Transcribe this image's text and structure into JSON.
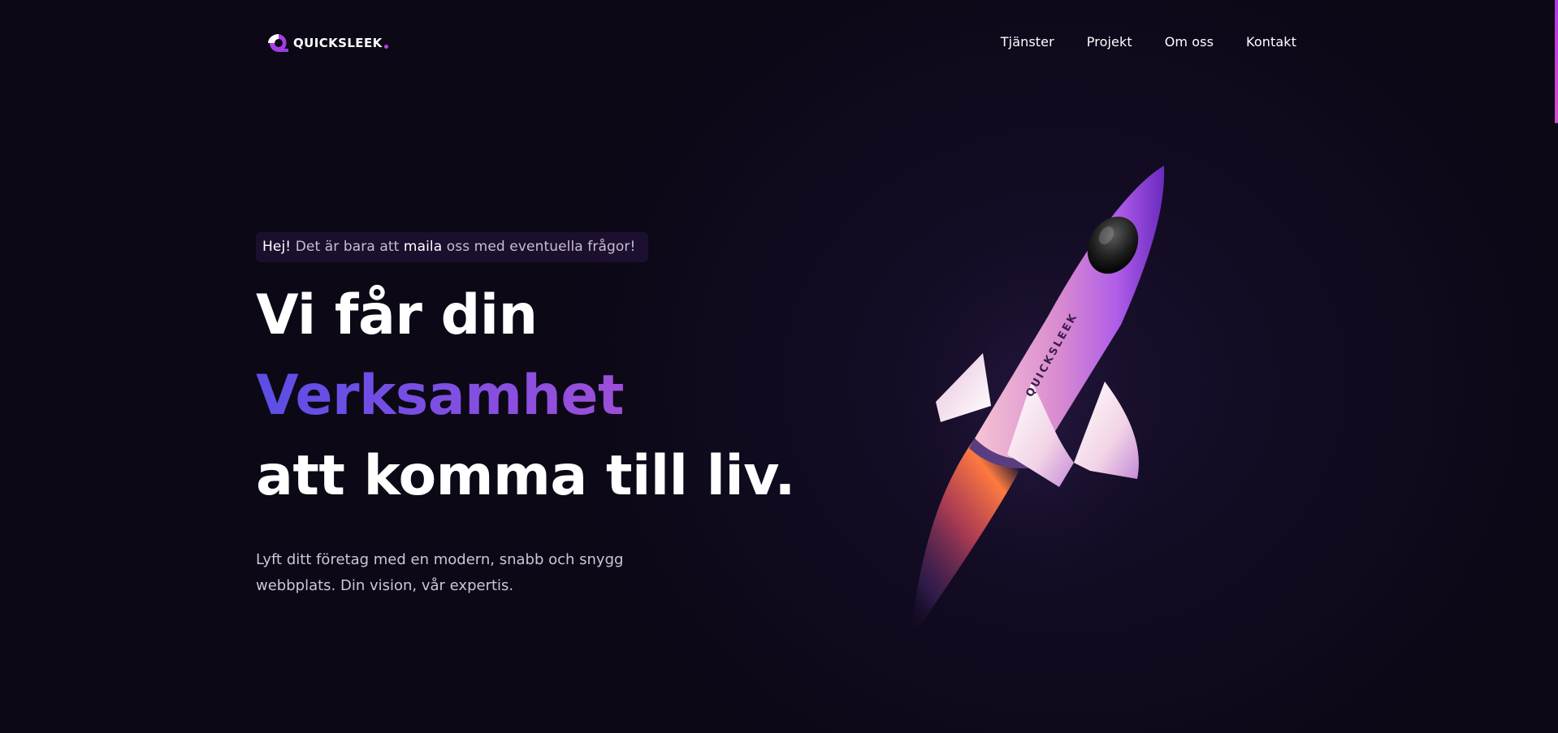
{
  "header": {
    "logo_text": "QUICKSLEEK",
    "nav": [
      "Tjänster",
      "Projekt",
      "Om oss",
      "Kontakt"
    ]
  },
  "hero": {
    "pill": {
      "greeting": "Hej!",
      "text_before": " Det är bara att ",
      "link": "maila",
      "text_after": " oss med eventuella frågor!"
    },
    "headline_line1": "Vi får din",
    "headline_line2": "Verksamhet",
    "headline_line3": "att komma till liv.",
    "subtext": "Lyft ditt företag med en modern, snabb och snygg webbplats. Din vision, vår expertis."
  },
  "rocket": {
    "label": "QUICKSLEEK"
  },
  "colors": {
    "background": "#0c0816",
    "accent_purple": "#c43ee6",
    "gradient_start": "#5b4ee5",
    "gradient_end": "#c04ec9"
  },
  "icons": [
    "logo-q-icon",
    "rocket-illustration"
  ]
}
